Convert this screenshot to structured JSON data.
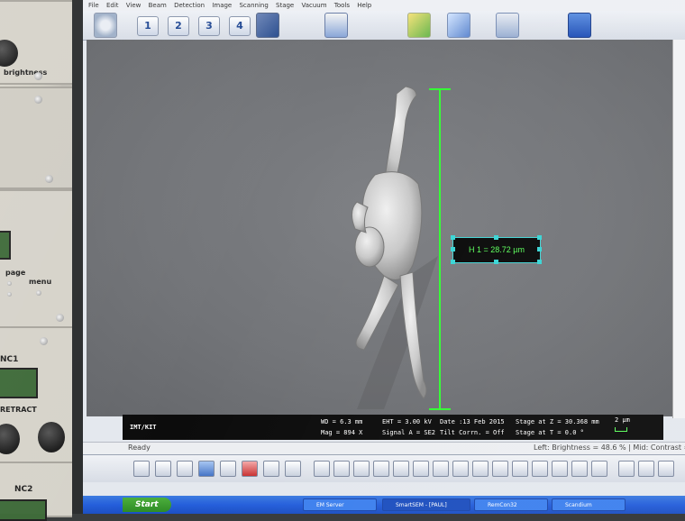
{
  "rack": {
    "brightness_label": "brightness",
    "page_label": "page",
    "menu_label": "menu",
    "nc1_label": "NC1",
    "retract_label": "RETRACT",
    "nc2_label": "NC2"
  },
  "menubar": [
    "File",
    "Edit",
    "View",
    "Beam",
    "Detection",
    "Image",
    "Scanning",
    "Stage",
    "Vacuum",
    "Tools",
    "Help"
  ],
  "toolbar": {
    "buttons": [
      "1",
      "2",
      "3",
      "4"
    ]
  },
  "measurement": {
    "label": "H 1 = 28.72 µm"
  },
  "infobar": {
    "logo": "IMT/KIT",
    "wd": "WD = 6.3 mm",
    "mag": "Mag =      894 X",
    "eht": "EHT = 3.00 kV",
    "signal": "Signal A = SE2",
    "date": "Date :13 Feb 2015",
    "tilt": "Tilt Corrn. = Off",
    "stage_z": "Stage at Z = 30.368 mm",
    "stage_t": "Stage at T =    0.0 °",
    "scale": "2 µm"
  },
  "status": {
    "ready": "Ready",
    "right": "Left: Brightness = 48.6 % | Mid: Contrast ="
  },
  "taskbar": {
    "start": "Start",
    "items": [
      "EM Server",
      "SmartSEM - [PAUL]",
      "RemCon32",
      "Scandium"
    ]
  },
  "colors": {
    "measure_line": "#33ff33",
    "measure_text": "#5cff5c",
    "handle": "#39d5d5"
  }
}
